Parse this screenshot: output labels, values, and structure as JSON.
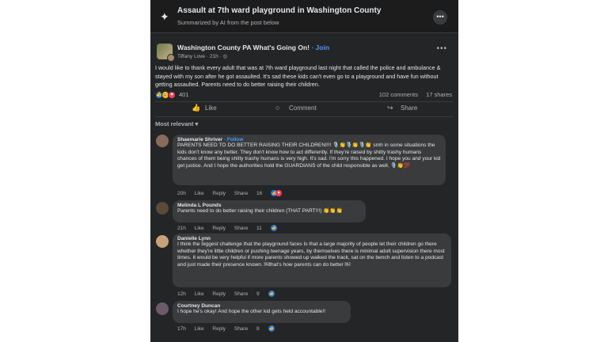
{
  "header": {
    "title": "Assault at 7th ward playground in Washington County",
    "subtitle": "Summarized by AI from the post below",
    "sparkle_icon": "sparkle-icon",
    "more_icon": "more-icon"
  },
  "post": {
    "group_name": "Washington County PA What's Going On!",
    "join_label": "· Join",
    "author": "Tiffany Love",
    "time": "· 21h ·",
    "audience_icon": "globe-icon",
    "text": "I would like to thank every adult that was at 7th ward playground last night that called the police and ambulance & stayed with my son after he got assaulted. It's sad these kids can't even go to a playground and have fun without getting assaulted. Parents need to do better raising their children.",
    "reaction_count": "401",
    "comments_count": "102 comments",
    "shares_count": "17 shares",
    "actions": {
      "like": "Like",
      "comment": "Comment",
      "share": "Share"
    }
  },
  "sort_label": "Most relevant",
  "comments": [
    {
      "name": "Shaemarie Shriver",
      "follow": "· Follow",
      "text": "PARENTS NEED TO DO BETTER RAISING THEIR CHILDREN!!!! 🎙️👏🎙️👏🎙️👏 smh in some situations the kids don't know any better. They don't know how to act differently. If they're raised by shitty trashy humans chances of them being shitty trashy humans is very high. It's sad. I'm sorry this happened. I hope you and your kid get justice. And I hope the authorities hold the GUARDIANS of the child responsible as well. 🎙️👏💯",
      "time": "20h",
      "like": "Like",
      "reply": "Reply",
      "share": "Share",
      "count": "16"
    },
    {
      "name": "Melinda L Pounds",
      "follow": "",
      "text": "Parents need to do better raising their children (THAT PART!!!) 👏👏👏",
      "time": "21h",
      "like": "Like",
      "reply": "Reply",
      "share": "Share",
      "count": "11"
    },
    {
      "name": "Danielle Lynn",
      "follow": "",
      "text": "I think the biggest challenge that the playground faces Is that a large majority of people let their children go there whether they're little children or pushing teenage years, by themselves there is minimal adult supervision there most times. It would be very helpful if more parents showed up walked the track, sat on the bench and listen to a podcast and just made their presence known. ￼that's how parents can do better ￼",
      "time": "12h",
      "like": "Like",
      "reply": "Reply",
      "share": "Share",
      "count": "9"
    },
    {
      "name": "Courtney Duncan",
      "follow": "",
      "text": "I hope he's okay! And hope the other kid gets held accountable!!",
      "time": "17h",
      "like": "Like",
      "reply": "Reply",
      "share": "Share",
      "count": "8"
    }
  ]
}
